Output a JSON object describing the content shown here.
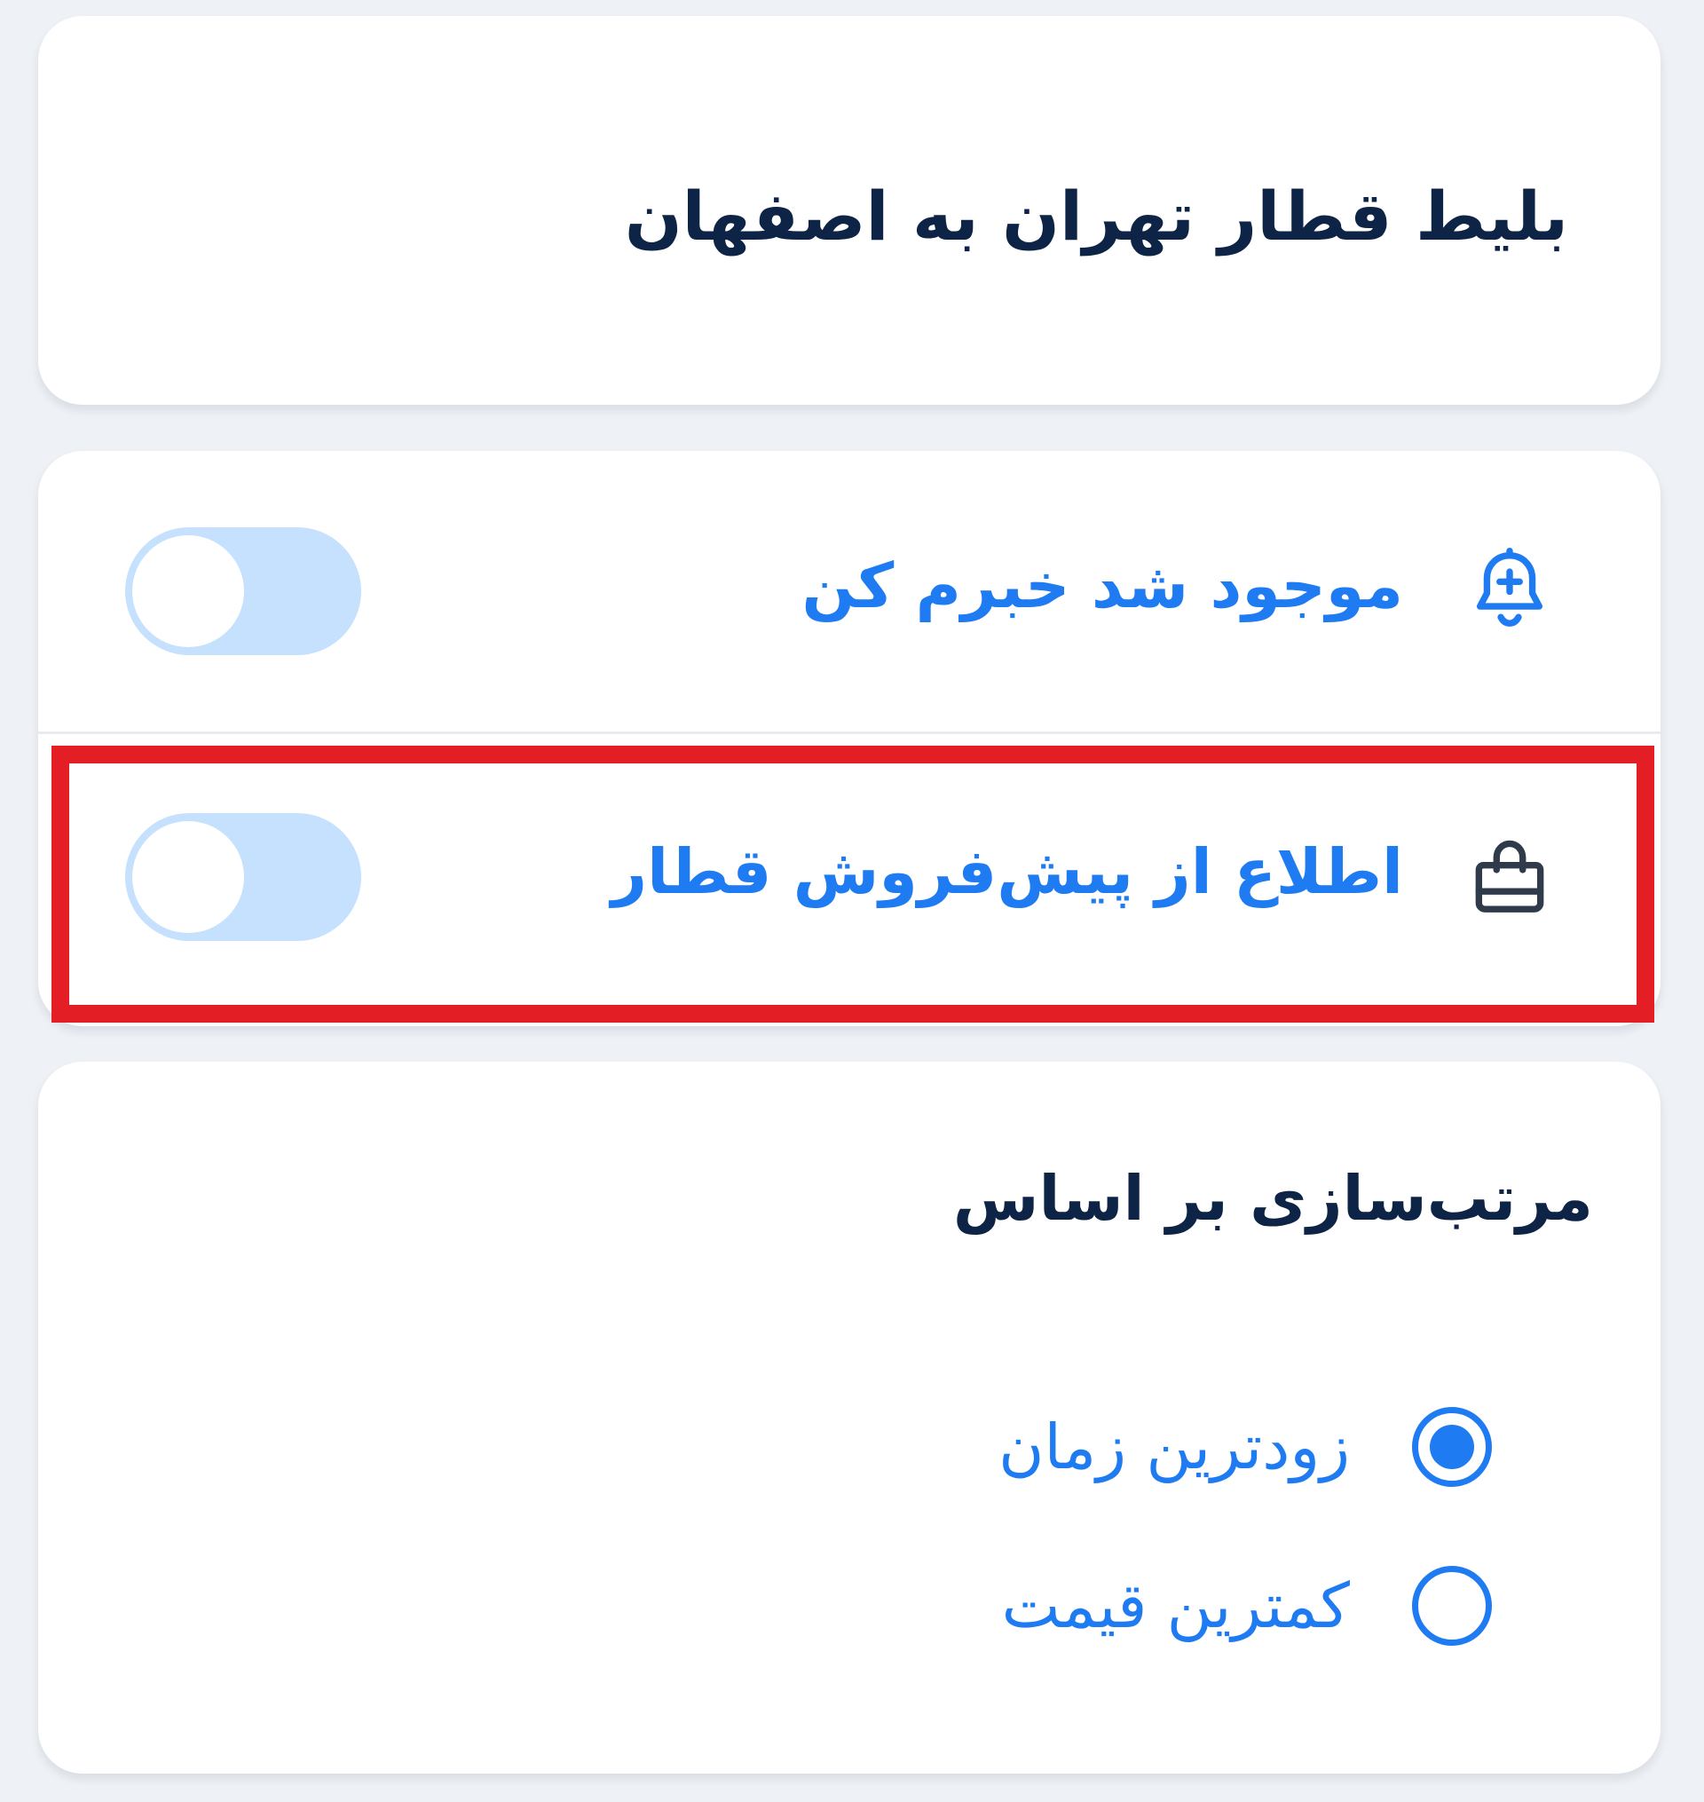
{
  "colors": {
    "page_background": "#eef1f5",
    "card_background": "#ffffff",
    "title_text": "#0d2446",
    "accent_blue": "#1f7bf2",
    "toggle_track_off": "#c5e1fd",
    "icon_dark": "#2f3a4b",
    "highlight_red": "#e31e24"
  },
  "title_card": {
    "title": "بلیط قطار تهران به اصفهان"
  },
  "alerts": {
    "notify_when_available": {
      "icon": "bell-plus-icon",
      "label": "موجود شد خبرم کن",
      "toggle_on": false
    },
    "presale_notice": {
      "icon": "shopping-bag-icon",
      "label": "اطلاع از پیش‌فروش قطار",
      "toggle_on": false,
      "highlighted": true
    }
  },
  "sort": {
    "heading": "مرتب‌سازی بر اساس",
    "options": [
      {
        "label": "زودترین زمان",
        "selected": true
      },
      {
        "label": "کمترین قیمت",
        "selected": false
      }
    ]
  }
}
